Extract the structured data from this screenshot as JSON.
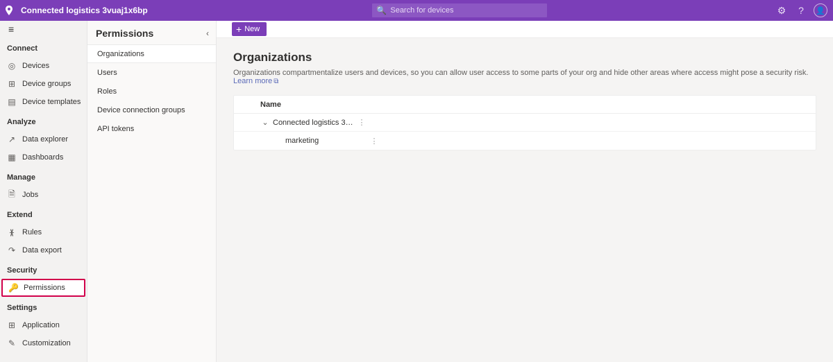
{
  "header": {
    "app_title": "Connected logistics 3vuaj1x6bp",
    "search_placeholder": "Search for devices"
  },
  "nav": {
    "groups": [
      {
        "label": "Connect",
        "items": [
          {
            "icon": "◎",
            "label": "Devices"
          },
          {
            "icon": "⊞",
            "label": "Device groups"
          },
          {
            "icon": "▤",
            "label": "Device templates"
          }
        ]
      },
      {
        "label": "Analyze",
        "items": [
          {
            "icon": "↗",
            "label": "Data explorer"
          },
          {
            "icon": "▦",
            "label": "Dashboards"
          }
        ]
      },
      {
        "label": "Manage",
        "items": [
          {
            "icon": "🗎",
            "label": "Jobs"
          }
        ]
      },
      {
        "label": "Extend",
        "items": [
          {
            "icon": "ᚕ",
            "label": "Rules"
          },
          {
            "icon": "↷",
            "label": "Data export"
          }
        ]
      },
      {
        "label": "Security",
        "items": [
          {
            "icon": "🔑",
            "label": "Permissions",
            "highlight": true
          }
        ]
      },
      {
        "label": "Settings",
        "items": [
          {
            "icon": "⊞",
            "label": "Application"
          },
          {
            "icon": "✎",
            "label": "Customization"
          }
        ]
      }
    ]
  },
  "subnav": {
    "title": "Permissions",
    "items": [
      {
        "label": "Organizations",
        "active": true
      },
      {
        "label": "Users"
      },
      {
        "label": "Roles"
      },
      {
        "label": "Device connection groups"
      },
      {
        "label": "API tokens"
      }
    ]
  },
  "toolbar": {
    "new_label": "New"
  },
  "page": {
    "title": "Organizations",
    "description": "Organizations compartmentalize users and devices, so you can allow user access to some parts of your org and hide other areas where access might pose a security risk.",
    "learn_more": "Learn more"
  },
  "table": {
    "col_name": "Name",
    "rows": [
      {
        "name": "Connected logistics 3v...",
        "level": 0,
        "expandable": true
      },
      {
        "name": "marketing",
        "level": 1,
        "expandable": false
      }
    ]
  }
}
